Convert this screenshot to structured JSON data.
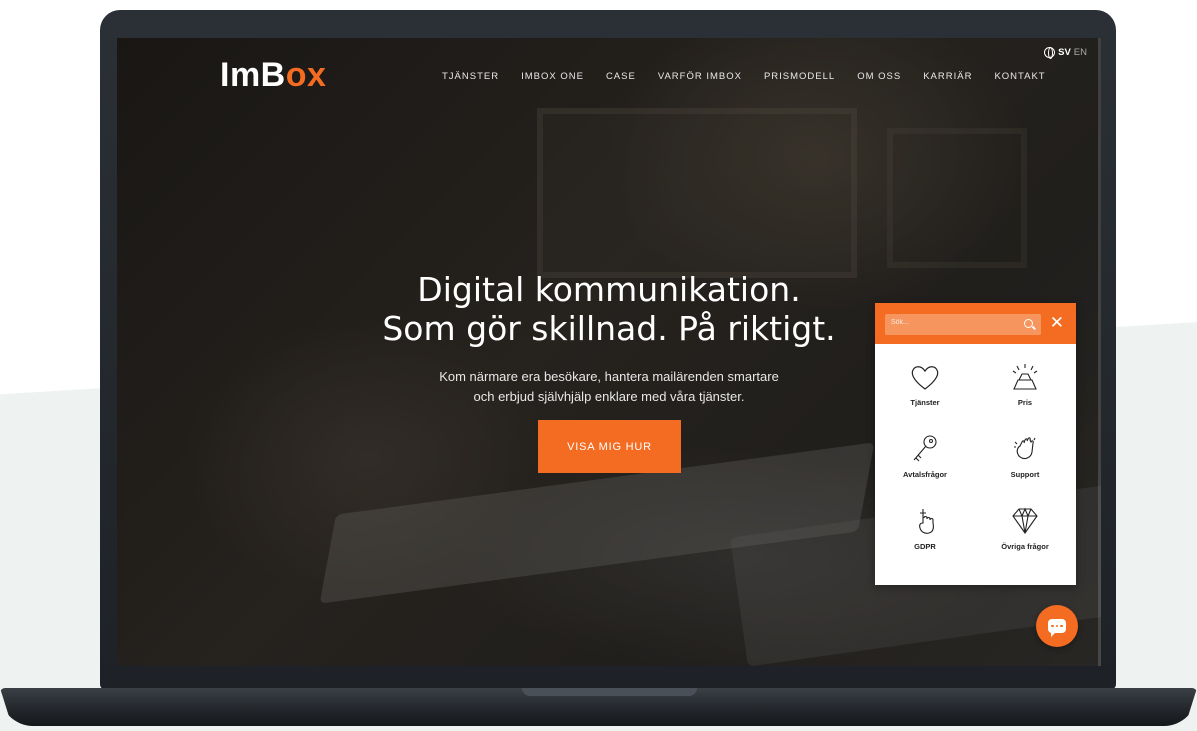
{
  "brand": {
    "logo_text_a": "ImB",
    "logo_text_b": "x",
    "accent": "#f36c21"
  },
  "nav": {
    "items": [
      {
        "label": "TJÄNSTER"
      },
      {
        "label": "IMBOX ONE"
      },
      {
        "label": "CASE"
      },
      {
        "label": "VARFÖR IMBOX"
      },
      {
        "label": "PRISMODELL"
      },
      {
        "label": "OM OSS"
      },
      {
        "label": "KARRIÄR"
      },
      {
        "label": "KONTAKT"
      }
    ]
  },
  "lang": {
    "active": "SV",
    "other": "EN",
    "icon": "globe-icon"
  },
  "hero": {
    "title_line1": "Digital kommunikation.",
    "title_line2": "Som gör skillnad. På riktigt.",
    "sub_line1": "Kom närmare era besökare, hantera mailärenden smartare",
    "sub_line2": "och erbjud självhjälp enklare med våra tjänster.",
    "cta_label": "VISA MIG HUR"
  },
  "widget": {
    "search_placeholder": "Sök...",
    "close_label": "✕",
    "items": [
      {
        "label": "Tjänster",
        "icon": "heart-icon"
      },
      {
        "label": "Pris",
        "icon": "gold-bars-icon"
      },
      {
        "label": "Avtalsfrågor",
        "icon": "key-icon"
      },
      {
        "label": "Support",
        "icon": "waving-hand-icon"
      },
      {
        "label": "GDPR",
        "icon": "pointing-finger-icon"
      },
      {
        "label": "Övriga frågor",
        "icon": "diamond-icon"
      }
    ]
  },
  "chat": {
    "icon": "chat-bubble-icon"
  }
}
